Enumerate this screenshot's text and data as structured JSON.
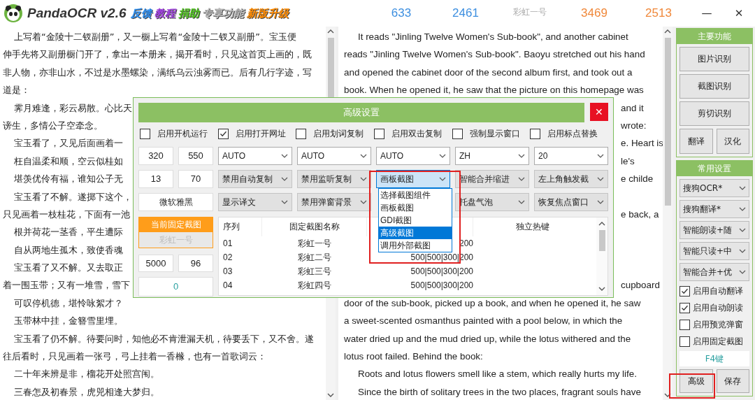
{
  "title_bar": {
    "app_name": "PandaOCR v2.6",
    "tags": [
      {
        "label": "反馈",
        "color": "#2f8ff0"
      },
      {
        "label": "教程",
        "color": "#a040e0"
      },
      {
        "label": "捐助",
        "color": "#4cc21a"
      },
      {
        "label": "专享功能",
        "color": "#bdbdbd"
      },
      {
        "label": "新版升级",
        "color": "#ff8a00"
      }
    ],
    "stats": [
      {
        "text": "633",
        "color": "#3d8fe0"
      },
      {
        "text": "2461",
        "color": "#3d8fe0"
      },
      {
        "text": "彩虹一号",
        "color": "#a8a8a8"
      },
      {
        "text": "3469",
        "color": "#f0883a"
      },
      {
        "text": "2513",
        "color": "#f0883a"
      }
    ],
    "minimize": "—",
    "close": "✕"
  },
  "left_text": {
    "lines": [
      {
        "text": "上写着“金陵十二钗副册”，又一橱上写着“金陵十二钗又副册”。宝玉便",
        "indent": true
      },
      {
        "text": "伸手先将又副册橱门开了，拿出一本册来，揭开看时，只见这首页上画的，既",
        "indent": false
      },
      {
        "text": "非人物，亦非山水，不过是水墨螺染，满纸乌云浊雾而已。后有几行字迹，写",
        "indent": false
      },
      {
        "text": "道是：",
        "indent": false
      },
      {
        "text": "霁月难逢，彩云易散。心比天",
        "indent": true
      },
      {
        "text": "谤生，多情公子空牵念。",
        "indent": false
      },
      {
        "text": "宝玉看了，又见后面画着一",
        "indent": true
      },
      {
        "text": "枉自温柔和顺，空云似桂如",
        "indent": true
      },
      {
        "text": "堪羡优伶有福，谁知公子无",
        "indent": true
      },
      {
        "text": "宝玉看了不解。遂掷下这个，",
        "indent": true
      },
      {
        "text": "只见画着一枝桂花，下面有一池",
        "indent": false
      },
      {
        "text": "根并荷花一茎香，平生遭际",
        "indent": true
      },
      {
        "text": "自从两地生孤木，致使香魂",
        "indent": true
      },
      {
        "text": "宝玉看了又不解。又去取正",
        "indent": true
      },
      {
        "text": "着一围玉带；又有一堆雪，雪下",
        "indent": false
      },
      {
        "text": "可叹停机德，堪怜咏絮才？",
        "indent": true
      },
      {
        "text": "玉带林中挂，金簪雪里埋。",
        "indent": true
      },
      {
        "text": "宝玉看了仍不解。待要问时，知他必不肯泄漏天机，待要丢下，又不舍。遂",
        "indent": true
      },
      {
        "text": "往后看时，只见画着一张弓，弓上挂着一香橼，也有一首歌词云：",
        "indent": false
      },
      {
        "text": "二十年来辨是非，榴花开处照宫闱。",
        "indent": true
      },
      {
        "text": "三春怎及初春景，虎兕相逢大梦归。",
        "indent": true
      }
    ]
  },
  "right_text": {
    "lines": [
      {
        "kind": "full",
        "text": "It reads \"Jinling Twelve Women's Sub-book\", and another cabinet",
        "indent": true
      },
      {
        "kind": "full",
        "text": "reads \"Jinling Twelve Women's Sub-book\". Baoyu stretched out his hand",
        "indent": false
      },
      {
        "kind": "full",
        "text": "and opened the cabinet door of the second album first, and took out a",
        "indent": false
      },
      {
        "kind": "full",
        "text": "book. When he opened it, he saw that the picture on this homepage was",
        "indent": false
      },
      {
        "kind": "clipped",
        "text": "and it",
        "indent": false
      },
      {
        "kind": "clipped",
        "text": "wrote:",
        "indent": false
      },
      {
        "kind": "clipped",
        "text": "e. Heart is",
        "indent": false
      },
      {
        "kind": "clipped",
        "text": "le's",
        "indent": false
      },
      {
        "kind": "clipped",
        "text": "e childe",
        "indent": false
      },
      {
        "kind": "covered"
      },
      {
        "kind": "clipped",
        "text": "e back, a",
        "indent": false
      },
      {
        "kind": "covered"
      },
      {
        "kind": "covered"
      },
      {
        "kind": "covered"
      },
      {
        "kind": "clipped",
        "text": "cupboard",
        "indent": false
      },
      {
        "kind": "full",
        "text": "door of the sub-book, picked up a book, and when he opened it, he saw",
        "indent": false
      },
      {
        "kind": "full",
        "text": "a sweet-scented osmanthus painted with a pool below, in which the",
        "indent": false
      },
      {
        "kind": "full",
        "text": "water dried up and the mud dried up, while the lotus withered and the",
        "indent": false
      },
      {
        "kind": "full",
        "text": "lotus root failed. Behind the book:",
        "indent": false
      },
      {
        "kind": "full",
        "text": "Roots and lotus flowers smell like a stem, which really hurts my life.",
        "indent": true
      },
      {
        "kind": "full",
        "text": "Since the birth of solitary trees in the two places, fragrant souls have",
        "indent": true
      }
    ]
  },
  "dialog": {
    "title": "高级设置",
    "close": "✕",
    "checkboxes": [
      {
        "label": "启用开机运行",
        "checked": false
      },
      {
        "label": "启用打开网址",
        "checked": true
      },
      {
        "label": "启用划词复制",
        "checked": false
      },
      {
        "label": "启用双击复制",
        "checked": false
      },
      {
        "label": "强制显示窗口",
        "checked": false
      },
      {
        "label": "启用标点替换",
        "checked": false
      }
    ],
    "rows": [
      {
        "fields": [
          "320",
          "550"
        ],
        "dropdowns": [
          {
            "kind": "select",
            "value": "AUTO"
          },
          {
            "kind": "select",
            "value": "AUTO"
          },
          {
            "kind": "select",
            "value": "AUTO"
          },
          {
            "kind": "select",
            "value": "ZH"
          },
          {
            "kind": "select",
            "value": "20"
          }
        ]
      },
      {
        "fields": [
          "13",
          "70"
        ],
        "dropdowns": [
          {
            "kind": "button",
            "value": "禁用自动复制"
          },
          {
            "kind": "button",
            "value": "禁用监听复制"
          },
          {
            "kind": "open",
            "value": "画板截图"
          },
          {
            "kind": "button",
            "value": "智能合并缩进"
          },
          {
            "kind": "button",
            "value": "左上角触发截"
          }
        ]
      },
      {
        "fields": [
          "微软雅黑"
        ],
        "dropdowns": [
          {
            "kind": "button",
            "value": "显示译文"
          },
          {
            "kind": "button",
            "value": "禁用弹窗背景"
          },
          {
            "kind": "covered"
          },
          {
            "kind": "button",
            "value": "托盘气泡"
          },
          {
            "kind": "button",
            "value": "恢复焦点窗口"
          }
        ]
      }
    ],
    "fixed_capture": {
      "button": "当前固定截图",
      "current": "彩虹一号"
    },
    "size_fields": [
      "5000",
      "96"
    ],
    "counter": "0",
    "table": {
      "columns": [
        {
          "kind": "label",
          "label": "序列"
        },
        {
          "kind": "label",
          "label": "固定截图名称"
        },
        {
          "kind": "covered"
        },
        {
          "kind": "label",
          "label": "独立热键"
        }
      ],
      "rows": [
        {
          "cells": [
            "01",
            "彩虹一号",
            "200"
          ]
        },
        {
          "cells": [
            "02",
            "彩虹二号",
            "500|500|300|200"
          ]
        },
        {
          "cells": [
            "03",
            "彩虹三号",
            "500|500|300|200"
          ]
        },
        {
          "cells": [
            "04",
            "彩虹四号",
            "500|500|300|200"
          ]
        }
      ]
    },
    "dropdown_list": {
      "options": [
        {
          "label": "选择截图组件",
          "selected": false
        },
        {
          "label": "画板截图",
          "selected": false
        },
        {
          "label": "GDI截图",
          "selected": false
        },
        {
          "label": "高级截图",
          "selected": true
        },
        {
          "label": "调用外部截图",
          "selected": false
        }
      ]
    }
  },
  "sidebar": {
    "main": {
      "title": "主要功能",
      "wide_buttons": [
        "图片识别",
        "截图识别",
        "剪切识别"
      ],
      "half_buttons": [
        "翻译",
        "汉化"
      ]
    },
    "settings": {
      "title": "常用设置",
      "dropdowns": [
        "搜狗OCR*",
        "搜狗翻译*",
        "智能朗读+随",
        "智能只读+中",
        "智能合并+优"
      ],
      "checkboxes": [
        {
          "label": "启用自动翻译",
          "checked": true
        },
        {
          "label": "启用自动朗读",
          "checked": true
        },
        {
          "label": "启用预览弹窗",
          "checked": false
        },
        {
          "label": "启用固定截图",
          "checked": false
        }
      ],
      "hotkey": "F4键",
      "buttons": [
        "高级",
        "保存"
      ]
    }
  }
}
